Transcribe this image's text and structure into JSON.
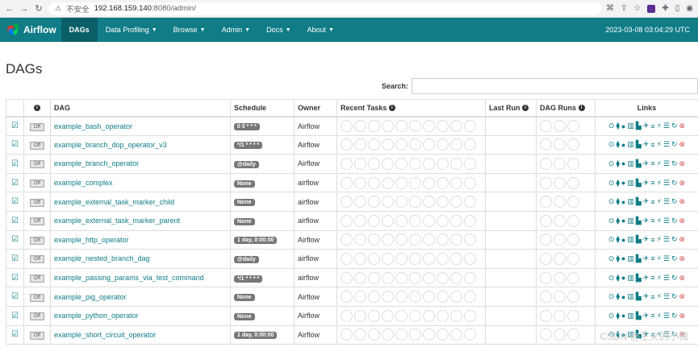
{
  "browser": {
    "back": "←",
    "forward": "→",
    "reload": "↻",
    "warning_icon": "⚠",
    "insecure_label": "不安全",
    "host": "192.168.159.140",
    "path": ":8080/admin/"
  },
  "nav": {
    "brand": "Airflow",
    "items": [
      {
        "label": "DAGs",
        "active": true,
        "dropdown": false
      },
      {
        "label": "Data Profiling",
        "active": false,
        "dropdown": true
      },
      {
        "label": "Browse",
        "active": false,
        "dropdown": true
      },
      {
        "label": "Admin",
        "active": false,
        "dropdown": true
      },
      {
        "label": "Docs",
        "active": false,
        "dropdown": true
      },
      {
        "label": "About",
        "active": false,
        "dropdown": true
      }
    ],
    "datetime": "2023-03-08 03:04:29 UTC"
  },
  "page": {
    "title": "DAGs",
    "search_label": "Search:",
    "search_value": ""
  },
  "table": {
    "headers": {
      "dag": "DAG",
      "schedule": "Schedule",
      "owner": "Owner",
      "recent_tasks": "Recent Tasks",
      "last_run": "Last Run",
      "dag_runs": "DAG Runs",
      "links": "Links"
    },
    "toggle_label": "Off",
    "rows": [
      {
        "dag": "example_bash_operator",
        "schedule": "0 0 * * *",
        "owner": "Airflow"
      },
      {
        "dag": "example_branch_dop_operator_v3",
        "schedule": "*/1 * * * *",
        "owner": "Airflow"
      },
      {
        "dag": "example_branch_operator",
        "schedule": "@daily",
        "owner": "Airflow"
      },
      {
        "dag": "example_complex",
        "schedule": "None",
        "owner": "airflow"
      },
      {
        "dag": "example_external_task_marker_child",
        "schedule": "None",
        "owner": "airflow"
      },
      {
        "dag": "example_external_task_marker_parent",
        "schedule": "None",
        "owner": "airflow"
      },
      {
        "dag": "example_http_operator",
        "schedule": "1 day, 0:00:00",
        "owner": "Airflow"
      },
      {
        "dag": "example_nested_branch_dag",
        "schedule": "@daily",
        "owner": "airflow"
      },
      {
        "dag": "example_passing_params_via_test_command",
        "schedule": "*/1 * * * *",
        "owner": "airflow"
      },
      {
        "dag": "example_pig_operator",
        "schedule": "None",
        "owner": "Airflow"
      },
      {
        "dag": "example_python_operator",
        "schedule": "None",
        "owner": "Airflow"
      },
      {
        "dag": "example_short_circuit_operator",
        "schedule": "1 day, 0:00:00",
        "owner": "Airflow"
      }
    ],
    "link_icons": [
      "⊙",
      "⧫",
      "●",
      "▥",
      "▙",
      "✈",
      "≡",
      "⚡",
      "☰",
      "↻",
      "⊗"
    ]
  },
  "watermark": "CSDN @王义的小楠",
  "colors": {
    "navbar": "#0f7c86",
    "link": "#0f7c86",
    "delete": "#d9534f"
  }
}
